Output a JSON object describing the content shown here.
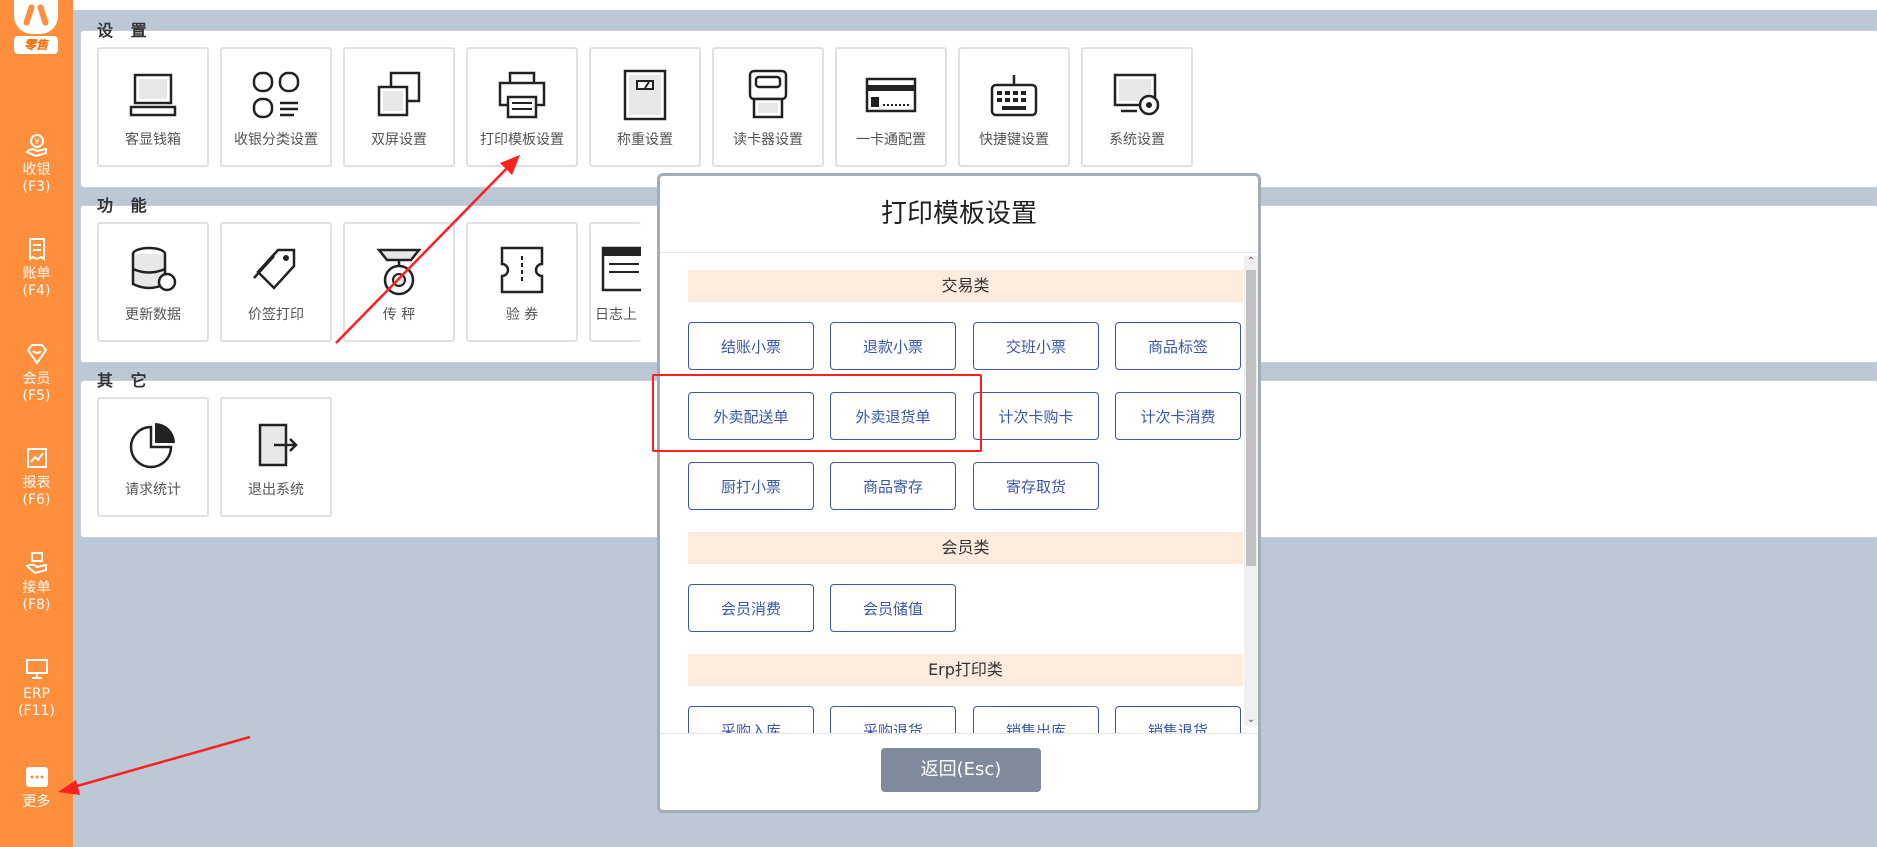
{
  "sidebar": {
    "logo_text": "零售",
    "items": [
      {
        "label": "收银",
        "key": "(F3)"
      },
      {
        "label": "账单",
        "key": "(F4)"
      },
      {
        "label": "会员",
        "key": "(F5)"
      },
      {
        "label": "报表",
        "key": "(F6)"
      },
      {
        "label": "接单",
        "key": "(F8)"
      },
      {
        "label": "ERP",
        "key": "(F11)"
      },
      {
        "label": "更多",
        "key": ""
      }
    ]
  },
  "sections": {
    "settings": {
      "title": "设 置",
      "tiles": [
        "客显钱箱",
        "收银分类设置",
        "双屏设置",
        "打印模板设置",
        "称重设置",
        "读卡器设置",
        "一卡通配置",
        "快捷键设置",
        "系统设置"
      ]
    },
    "functions": {
      "title": "功 能",
      "tiles": [
        "更新数据",
        "价签打印",
        "传 秤",
        "验 券",
        "日志上"
      ]
    },
    "others": {
      "title": "其 它",
      "tiles": [
        "请求统计",
        "退出系统"
      ]
    }
  },
  "modal": {
    "title": "打印模板设置",
    "groups": [
      {
        "title": "交易类",
        "buttons": [
          "结账小票",
          "退款小票",
          "交班小票",
          "商品标签",
          "外卖配送单",
          "外卖退货单",
          "计次卡购卡",
          "计次卡消费",
          "厨打小票",
          "商品寄存",
          "寄存取货"
        ]
      },
      {
        "title": "会员类",
        "buttons": [
          "会员消费",
          "会员储值"
        ]
      },
      {
        "title": "Erp打印类",
        "buttons": [
          "采购入库",
          "采购退货",
          "销售出库",
          "销售退货"
        ]
      }
    ],
    "back_label": "返回(Esc)"
  },
  "colors": {
    "sidebar": "#ff8f3c",
    "accent_blue": "#3b57a8",
    "section_bg": "#fdebdd",
    "annotation_red": "#ff2020"
  }
}
